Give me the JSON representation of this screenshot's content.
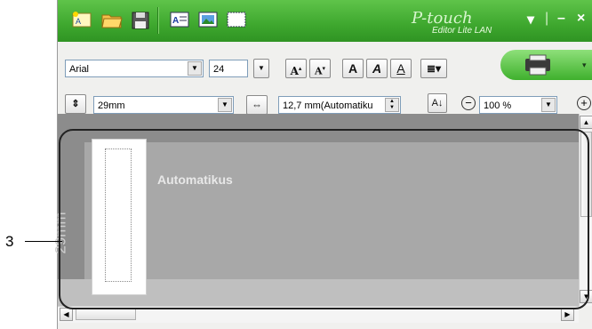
{
  "app": {
    "brand": "P-touch",
    "brand_sub": "Editor Lite LAN"
  },
  "window_controls": {
    "dropdown": "▾",
    "separator": "|",
    "minimize": "–",
    "close": "×"
  },
  "toolbar1": {
    "font": "Arial",
    "size": "24"
  },
  "toolbar2": {
    "tape_width": "29mm",
    "length": "12,7 mm(Automatiku",
    "zoom": "100 %"
  },
  "canvas": {
    "strip_label": "29mm",
    "label_text": "Automatikus"
  },
  "callout": {
    "number": "3"
  },
  "colors": {
    "titlebar": "#3ea72e",
    "canvas_gray": "#a8a8a8",
    "print_button": "#3fb02d"
  }
}
